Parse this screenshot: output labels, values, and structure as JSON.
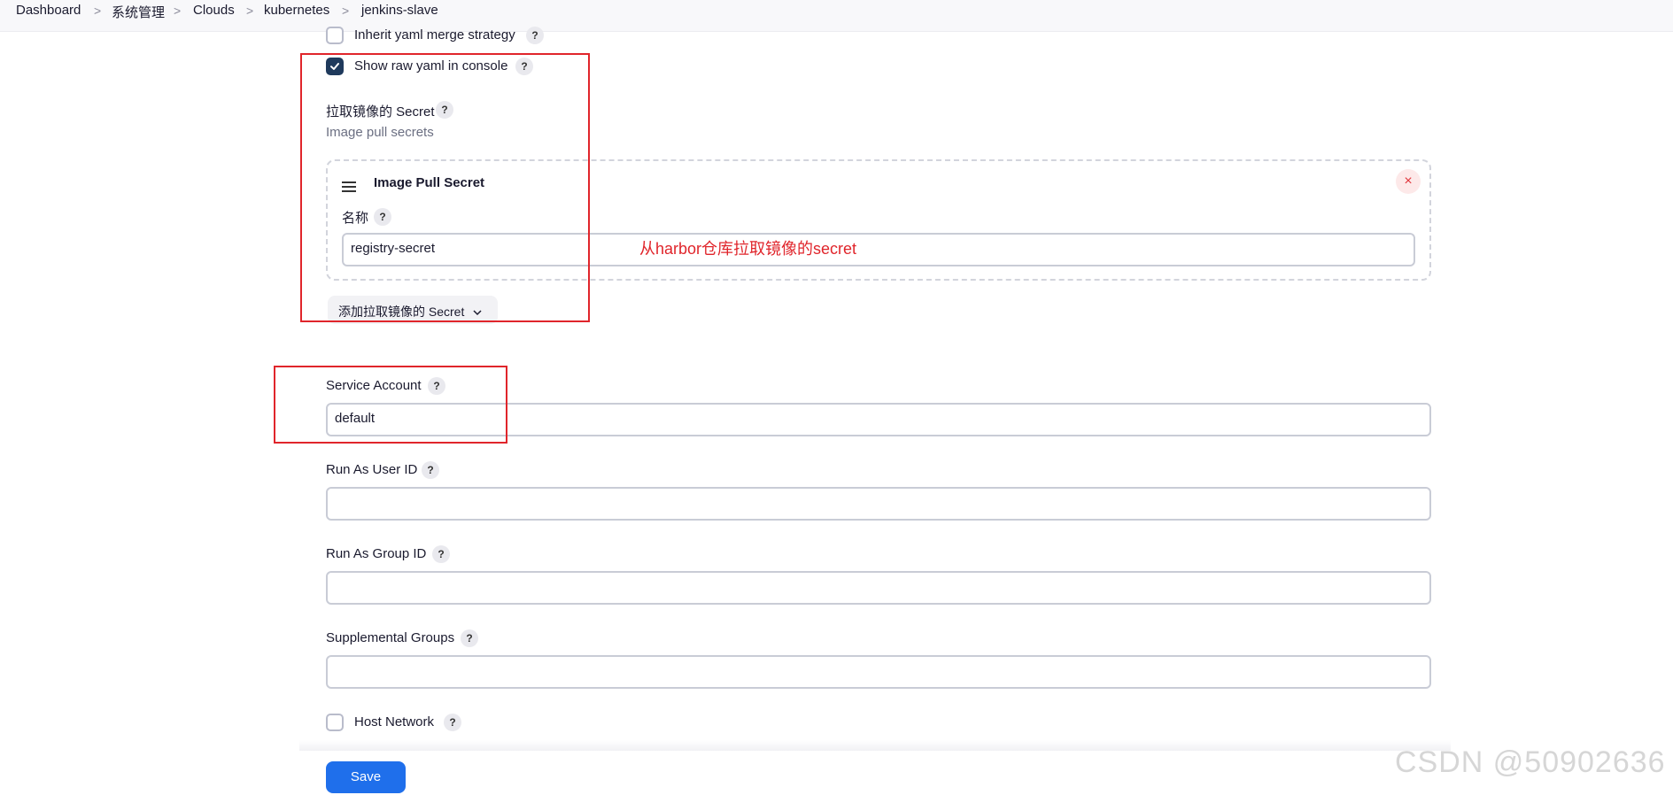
{
  "breadcrumb": {
    "items": [
      "Dashboard",
      "系统管理",
      "Clouds",
      "kubernetes",
      "jenkins-slave"
    ],
    "separator": ">"
  },
  "form": {
    "inherit_yaml": {
      "label": "Inherit yaml merge strategy",
      "checked": false
    },
    "show_raw_yaml": {
      "label": "Show raw yaml in console",
      "checked": true
    },
    "image_pull_secrets": {
      "label": "拉取镜像的 Secret",
      "description": "Image pull secrets",
      "item": {
        "title": "Image Pull Secret",
        "name_label": "名称",
        "name_value": "registry-secret",
        "close_symbol": "×"
      },
      "add_button_label": "添加拉取镜像的 Secret"
    },
    "service_account": {
      "label": "Service Account",
      "value": "default"
    },
    "run_as_user_id": {
      "label": "Run As User ID",
      "value": ""
    },
    "run_as_group_id": {
      "label": "Run As Group ID",
      "value": ""
    },
    "supplemental_groups": {
      "label": "Supplemental Groups",
      "value": ""
    },
    "host_network": {
      "label": "Host Network",
      "checked": false
    },
    "help_symbol": "?",
    "save_label": "Save"
  },
  "annotation": {
    "text": "从harbor仓库拉取镜像的secret",
    "color": "#e0252b"
  },
  "watermark": "CSDN @50902636",
  "colors": {
    "accent": "#1f6feb",
    "checkbox_checked": "#1f3a5c",
    "annotation": "#e0252b"
  }
}
